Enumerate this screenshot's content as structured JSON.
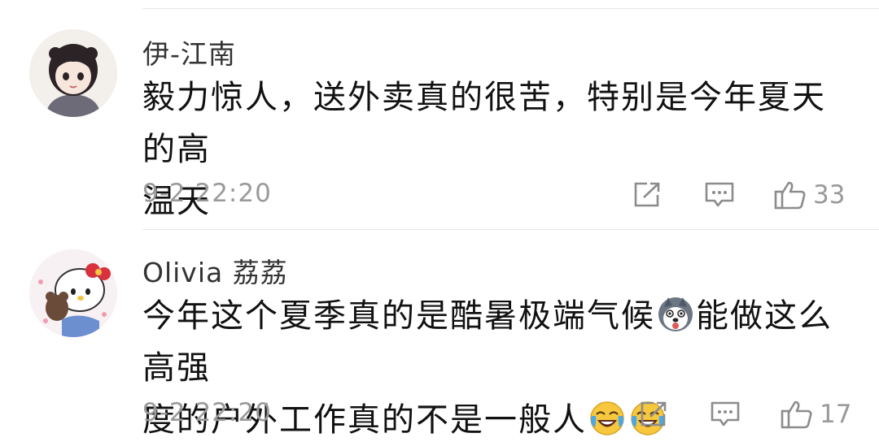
{
  "comments": [
    {
      "username": "伊-江南",
      "text_line1": "毅力惊人，送外卖真的很苦，特别是今年夏天的高",
      "text_line2": "温天",
      "time": "9-2 22:20",
      "likes": "33"
    },
    {
      "username": "Olivia 荔荔",
      "text_line1": "今年这个夏季真的是酷暑极端气候",
      "text_line1b": "能做这么高强",
      "text_line2": "度的户外工作真的不是一般人",
      "time": "9-2 22:20",
      "likes": "17"
    }
  ],
  "icons": {
    "share": "share-icon",
    "reply": "reply-icon",
    "like": "thumbs-up-icon"
  }
}
